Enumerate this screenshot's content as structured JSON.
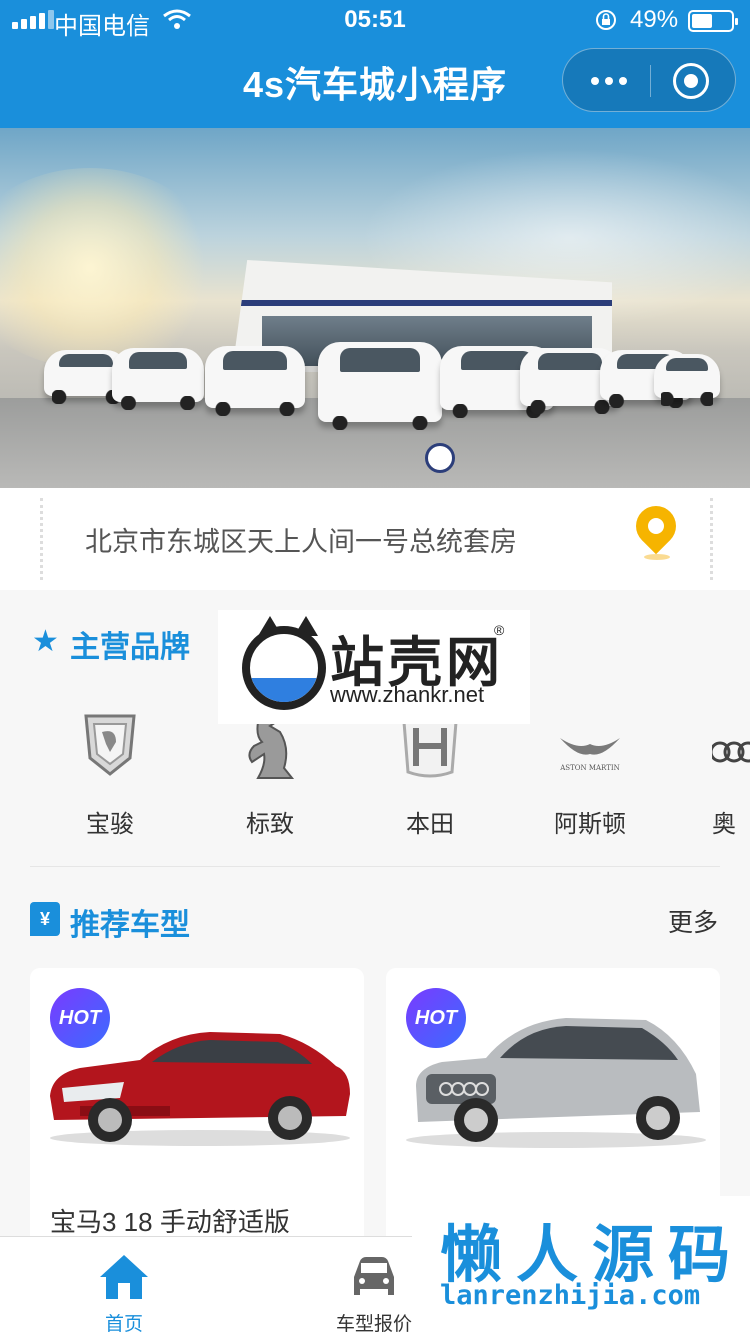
{
  "status_bar": {
    "carrier": "中国电信",
    "time": "05:51",
    "battery": "49%"
  },
  "nav": {
    "title": "4s汽车城小程序"
  },
  "address": {
    "text": "北京市东城区天上人间一号总统套房"
  },
  "brands": {
    "title": "主营品牌",
    "items": [
      {
        "label": "宝骏",
        "icon": "baojun-logo-icon"
      },
      {
        "label": "标致",
        "icon": "peugeot-logo-icon"
      },
      {
        "label": "本田",
        "icon": "honda-logo-icon"
      },
      {
        "label": "阿斯顿",
        "icon": "aston-martin-logo-icon"
      },
      {
        "label": "奥",
        "icon": "audi-logo-icon"
      }
    ],
    "aston_logo_text": "ASTON MARTIN"
  },
  "recommended": {
    "title": "推荐车型",
    "more": "更多",
    "cards": [
      {
        "badge": "HOT",
        "name": "宝马3 18 手动舒适版",
        "color": "#b3151d"
      },
      {
        "badge": "HOT",
        "name": "",
        "color": "#b9bcbf"
      }
    ]
  },
  "tabbar": {
    "tabs": [
      {
        "label": "首页",
        "active": true
      },
      {
        "label": "车型报价",
        "active": false
      }
    ],
    "active_color": "#1a8fdb"
  },
  "watermarks": {
    "zhankr_title": "站壳网",
    "zhankr_reg": "®",
    "zhankr_url": "www.zhankr.net",
    "lanren_title": "懒人源码",
    "lanren_url": "lanrenzhijia.com"
  }
}
